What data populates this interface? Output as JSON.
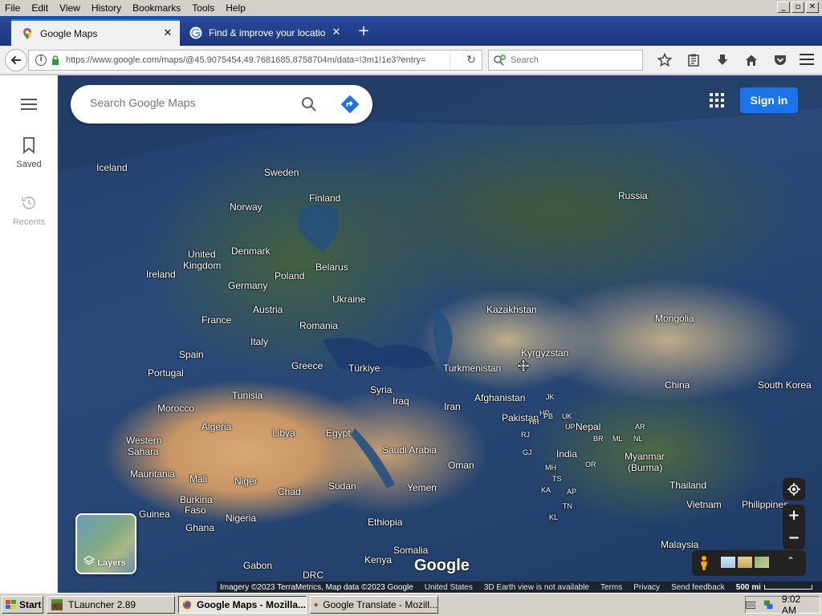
{
  "menubar": {
    "items": [
      "File",
      "Edit",
      "View",
      "History",
      "Bookmarks",
      "Tools",
      "Help"
    ],
    "window_controls": [
      "_",
      "▫",
      "✕"
    ]
  },
  "tabs": [
    {
      "label": "Google Maps",
      "active": true,
      "favicon": "maps-pin-icon"
    },
    {
      "label": "Find & improve your location's...",
      "active": false,
      "favicon": "google-g-icon"
    }
  ],
  "navbar": {
    "url": "https://www.google.com/maps/@45.9075454,49.7681685,8758704m/data=!3m1!1e3?entry=",
    "search_placeholder": "Search"
  },
  "sidebar": {
    "items": [
      {
        "label": "Saved",
        "icon": "bookmark-icon",
        "enabled": true
      },
      {
        "label": "Recents",
        "icon": "history-icon",
        "enabled": false
      }
    ]
  },
  "maps": {
    "search_placeholder": "Search Google Maps",
    "signin_label": "Sign in",
    "layers_label": "Layers",
    "logo_text": "Google",
    "labels": [
      {
        "text": "Iceland"
      },
      {
        "text": "Sweden"
      },
      {
        "text": "Finland"
      },
      {
        "text": "Norway"
      },
      {
        "text": "Russia"
      },
      {
        "text": "United"
      },
      {
        "text": "Kingdom"
      },
      {
        "text": "Denmark"
      },
      {
        "text": "Ireland"
      },
      {
        "text": "Belarus"
      },
      {
        "text": "Poland"
      },
      {
        "text": "Germany"
      },
      {
        "text": "Ukraine"
      },
      {
        "text": "Austria"
      },
      {
        "text": "France"
      },
      {
        "text": "Kazakhstan"
      },
      {
        "text": "Mongolia"
      },
      {
        "text": "Romania"
      },
      {
        "text": "Italy"
      },
      {
        "text": "Spain"
      },
      {
        "text": "Kyrgyzstan"
      },
      {
        "text": "Greece"
      },
      {
        "text": "Türkiye"
      },
      {
        "text": "Turkmenistan"
      },
      {
        "text": "Portugal"
      },
      {
        "text": "China"
      },
      {
        "text": "South Korea"
      },
      {
        "text": "Tunisia"
      },
      {
        "text": "Syria"
      },
      {
        "text": "Afghanistan"
      },
      {
        "text": "Iraq"
      },
      {
        "text": "Morocco"
      },
      {
        "text": "Iran"
      },
      {
        "text": "Pakistan"
      },
      {
        "text": "Algeria"
      },
      {
        "text": "Libya"
      },
      {
        "text": "Egypt"
      },
      {
        "text": "Nepal"
      },
      {
        "text": "Western"
      },
      {
        "text": "Sahara"
      },
      {
        "text": "Saudi Arabia"
      },
      {
        "text": "India"
      },
      {
        "text": "Myanmar"
      },
      {
        "text": "(Burma)"
      },
      {
        "text": "Oman"
      },
      {
        "text": "Mauritania"
      },
      {
        "text": "Mali"
      },
      {
        "text": "Niger"
      },
      {
        "text": "Thailand"
      },
      {
        "text": "Burkina"
      },
      {
        "text": "Faso"
      },
      {
        "text": "Chad"
      },
      {
        "text": "Sudan"
      },
      {
        "text": "Yemen"
      },
      {
        "text": "Vietnam"
      },
      {
        "text": "Philippines"
      },
      {
        "text": "Guinea"
      },
      {
        "text": "Nigeria"
      },
      {
        "text": "Ghana"
      },
      {
        "text": "Ethiopia"
      },
      {
        "text": "Malaysia"
      },
      {
        "text": "Somalia"
      },
      {
        "text": "Kenya"
      },
      {
        "text": "Gabon"
      },
      {
        "text": "DRC"
      }
    ],
    "state_labels": [
      "JK",
      "HP",
      "PB",
      "UK",
      "HR",
      "UP",
      "RJ",
      "BR",
      "AR",
      "ML",
      "NL",
      "GJ",
      "MH",
      "OR",
      "TS",
      "AP",
      "KA",
      "TN",
      "KL"
    ],
    "attribution": {
      "imagery": "Imagery ©2023 TerraMetrics, Map data ©2023 Google",
      "country": "United States",
      "earth": "3D Earth view is not available",
      "terms": "Terms",
      "privacy": "Privacy",
      "feedback": "Send feedback",
      "scale": "500 mi"
    }
  },
  "taskbar": {
    "start_label": "Start",
    "items": [
      {
        "label": "TLauncher 2.89",
        "active": false
      },
      {
        "label": "Google Maps - Mozilla...",
        "active": true
      },
      {
        "label": "Google Translate - Mozill...",
        "active": false
      }
    ],
    "clock": "9:02 AM"
  },
  "colors": {
    "accent": "#1a73e8",
    "titlebar": "#1e3a8a",
    "directions": "#1a73e8"
  }
}
